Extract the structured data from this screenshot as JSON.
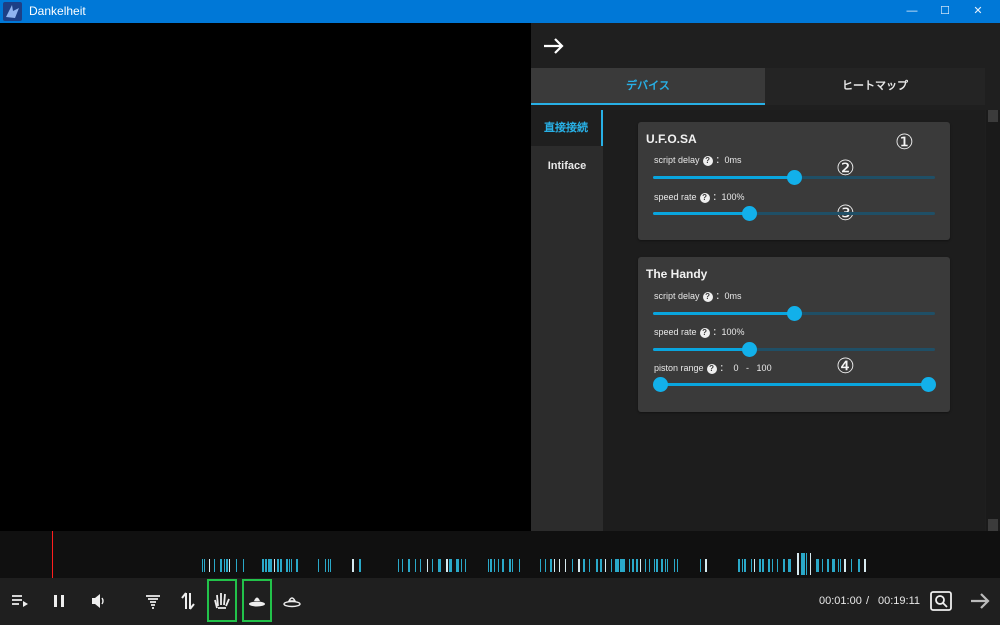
{
  "window": {
    "title": "Dankelheit",
    "minimize_glyph": "—",
    "maximize_glyph": "☐",
    "close_glyph": "✕"
  },
  "panel": {
    "back_icon": "arrow-right-icon",
    "tabs": [
      {
        "label": "デバイス",
        "active": true
      },
      {
        "label": "ヒートマップ",
        "active": false
      }
    ],
    "side_nav": [
      {
        "label": "直接接続",
        "active": true
      },
      {
        "label": "Intiface",
        "active": false
      }
    ],
    "devices": [
      {
        "name": "U.F.O.SA",
        "script_delay": {
          "label": "script delay",
          "value_text": "：0ms",
          "level": 0.5
        },
        "speed_rate": {
          "label": "speed rate",
          "value_text": "：100%",
          "level": 0.34
        },
        "markers": [
          "①",
          "②",
          "③"
        ]
      },
      {
        "name": "The Handy",
        "script_delay": {
          "label": "script delay",
          "value_text": "：0ms",
          "level": 0.5
        },
        "speed_rate": {
          "label": "speed rate",
          "value_text": "：100%",
          "level": 0.34
        },
        "piston_range": {
          "label": "piston range",
          "value_text": "：  0   -   100",
          "min": 0,
          "max": 100
        },
        "markers": [
          "④"
        ]
      }
    ],
    "help_glyph": "?"
  },
  "player": {
    "current_time": "00:01:00",
    "separator": "/",
    "total_time": "00:19:11",
    "controls": [
      "playlist-icon",
      "pause-icon",
      "volume-icon",
      "tornado-icon",
      "split-arrows-icon",
      "hand-icon",
      "ufo-icon",
      "ufo-alt-icon",
      "search-zoom-icon",
      "arrow-right-icon"
    ]
  },
  "colors": {
    "titlebar": "#0078d7",
    "accent": "#09a5de",
    "highlight_box": "#22c24a",
    "playhead": "#ff1e1e",
    "timeline_marks": "#2aa9c9"
  }
}
